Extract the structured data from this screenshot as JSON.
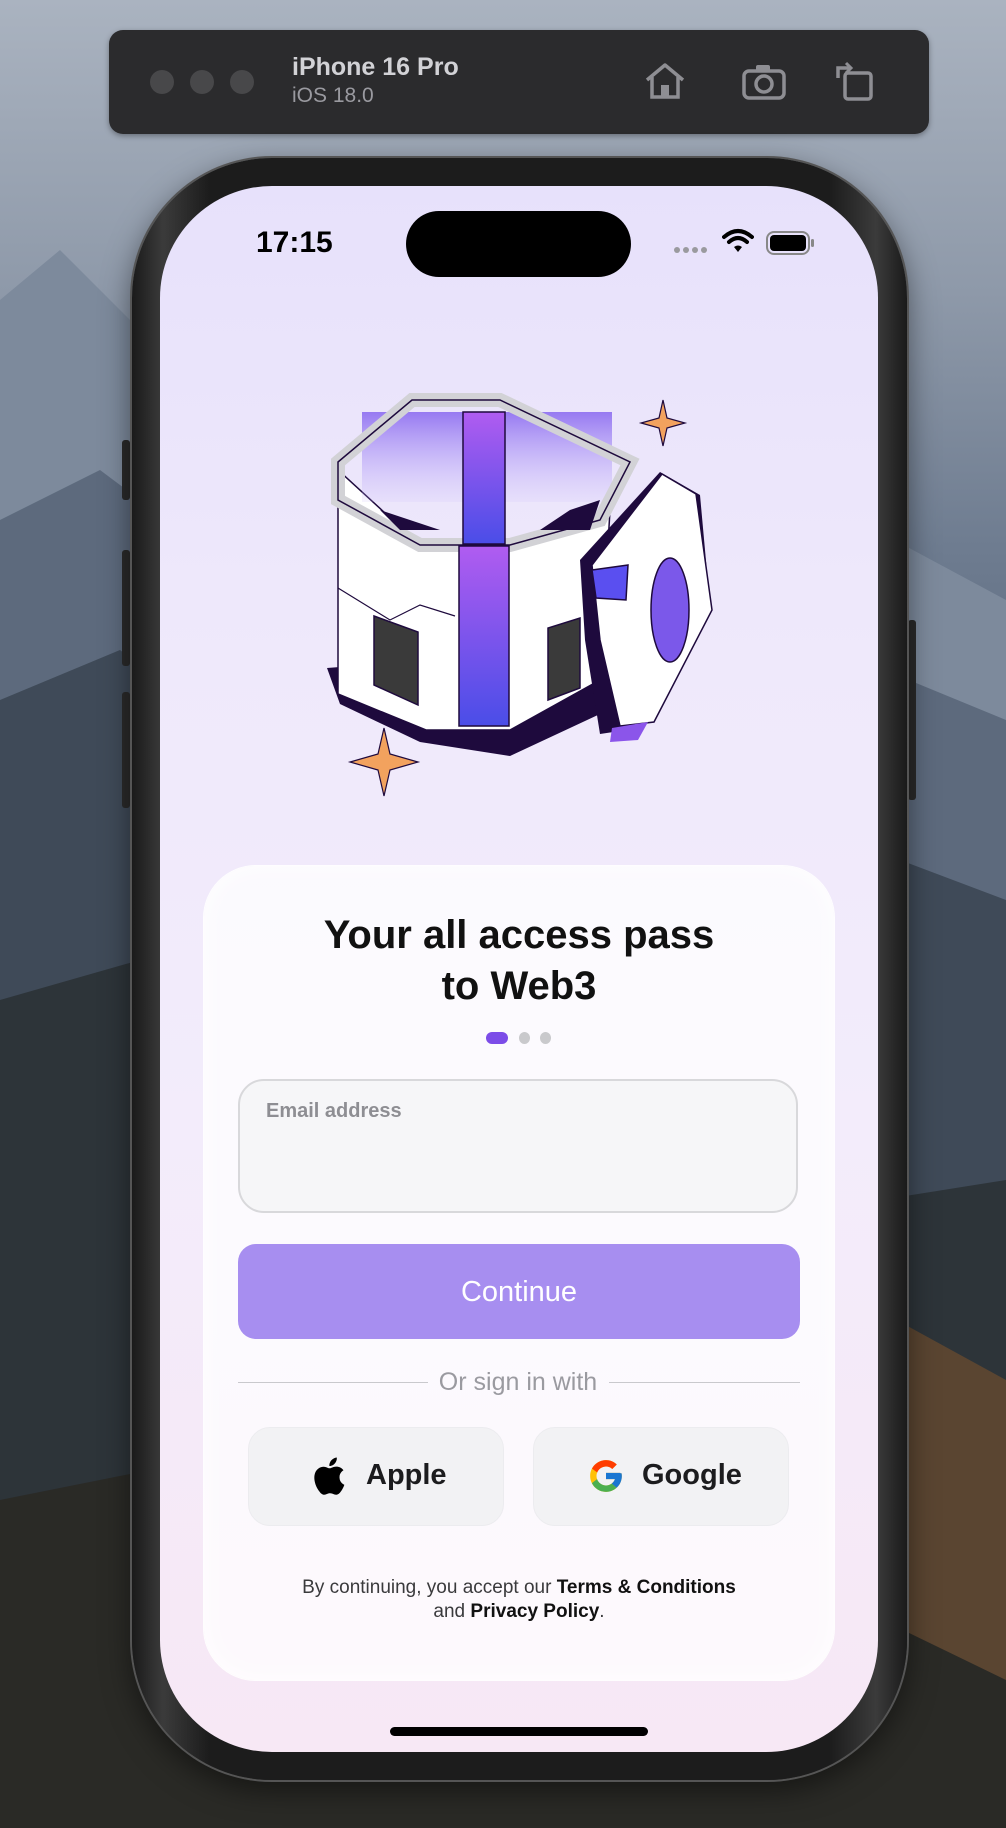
{
  "simulator": {
    "device_name": "iPhone 16 Pro",
    "os_version": "iOS 18.0",
    "toolbar_icons": [
      "home-icon",
      "screenshot-icon",
      "rotate-icon"
    ]
  },
  "status_bar": {
    "time": "17:15",
    "icons": [
      "cellular-icon",
      "wifi-icon",
      "battery-icon"
    ]
  },
  "hero": {
    "illustration": "isometric-portal-building-illustration"
  },
  "onboarding": {
    "headline_line1": "Your all access pass",
    "headline_line2": "to Web3",
    "page_indicator": {
      "current": 1,
      "total": 3
    }
  },
  "email": {
    "label": "Email address",
    "value": "",
    "placeholder": ""
  },
  "continue_label": "Continue",
  "divider_text": "Or sign in with",
  "social": {
    "apple_label": "Apple",
    "google_label": "Google"
  },
  "legal": {
    "prefix": "By continuing, you accept our ",
    "terms_link": "Terms & Conditions",
    "middle": "and ",
    "privacy_link": "Privacy Policy",
    "suffix": "."
  },
  "colors": {
    "accent": "#a78ef0",
    "indicator_active": "#7c4ce8",
    "star": "#f2a25e",
    "portal_purple": "#8b55ea",
    "base_dark": "#1f0a3f"
  }
}
